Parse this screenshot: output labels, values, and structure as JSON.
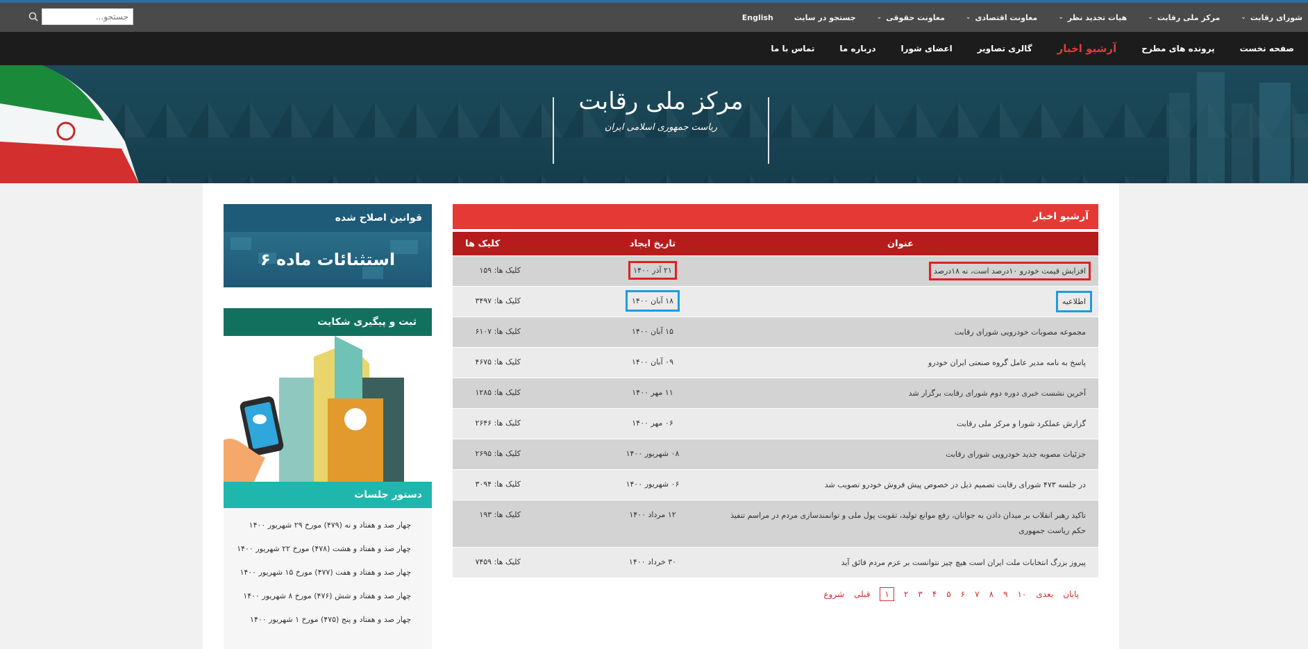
{
  "topbar": {
    "search_placeholder": "جستجو...",
    "items": [
      {
        "label": "شورای رقابت",
        "dropdown": true
      },
      {
        "label": "مرکز ملی رقابت",
        "dropdown": true
      },
      {
        "label": "هیات تجدید نظر",
        "dropdown": true
      },
      {
        "label": "معاونت اقتصادی",
        "dropdown": true
      },
      {
        "label": "معاونت حقوقی",
        "dropdown": true
      },
      {
        "label": "جستجو در سایت",
        "dropdown": false
      },
      {
        "label": "English",
        "dropdown": false
      }
    ]
  },
  "mainnav": {
    "items": [
      {
        "label": "صفحه نخست"
      },
      {
        "label": "پرونده های مطرح"
      },
      {
        "label": "آرشیو اخبار",
        "active": true
      },
      {
        "label": "گالری تصاویر"
      },
      {
        "label": "اعضای شورا"
      },
      {
        "label": "درباره ما"
      },
      {
        "label": "تماس با ما"
      }
    ]
  },
  "banner": {
    "title": "مرکز ملی رقابت",
    "subtitle": "ریاست جمهوری اسلامی ایران"
  },
  "archive": {
    "heading": "آرشیو اخبار",
    "columns": {
      "title": "عنوان",
      "date": "تاریخ ایجاد",
      "clicks": "کلیک ها"
    },
    "rows": [
      {
        "title": "افزایش قیمت خودرو ۱۰درصد است، نه ۱۸درصد",
        "date": "۲۱ آذر ۱۴۰۰",
        "clicks": "کلیک ها: ۱۵۹",
        "highlight": "red"
      },
      {
        "title": "اطلاعیه",
        "date": "۱۸ آبان ۱۴۰۰",
        "clicks": "کلیک ها: ۳۴۹۷",
        "highlight": "blue"
      },
      {
        "title": "مجموعه مصوبات خودرویی شورای رقابت",
        "date": "۱۵ آبان ۱۴۰۰",
        "clicks": "کلیک ها: ۶۱۰۷"
      },
      {
        "title": "پاسخ به نامه مدیر عامل گروه صنعتی ایران خودرو",
        "date": "۰۹ آبان ۱۴۰۰",
        "clicks": "کلیک ها: ۴۶۷۵"
      },
      {
        "title": "آخرین نشست خبری دوره دوم شورای رقابت برگزار شد",
        "date": "۱۱ مهر ۱۴۰۰",
        "clicks": "کلیک ها: ۱۲۸۵"
      },
      {
        "title": "گزارش عملکرد شورا و مرکز ملی رقابت",
        "date": "۰۶ مهر ۱۴۰۰",
        "clicks": "کلیک ها: ۲۶۴۶"
      },
      {
        "title": "جزئیات مصوبه جدید خودرویی شورای رقابت",
        "date": "۰۸ شهریور ۱۴۰۰",
        "clicks": "کلیک ها: ۲۶۹۵"
      },
      {
        "title": "در جلسه ۴۷۳ شورای رقابت تصمیم ذیل در خصوص پیش فروش خودرو تصویب شد",
        "date": "۰۶ شهریور ۱۴۰۰",
        "clicks": "کلیک ها: ۳۰۹۴"
      },
      {
        "title": "تاکید رهبر انقلاب بر میدان دادن به جوانان، رفع موانع تولید، تقویت پول ملی و توانمندسازی مردم در مراسم تنفیذ حکم ریاست جمهوری",
        "date": "۱۲ مرداد ۱۴۰۰",
        "clicks": "کلیک ها: ۱۹۳",
        "tall": true
      },
      {
        "title": "پیروز بزرگ انتخابات ملت ایران است هیچ چیز نتوانست بر عزم مردم فائق آید",
        "date": "۳۰ خرداد ۱۴۰۰",
        "clicks": "کلیک ها: ۷۴۵۹"
      }
    ],
    "pager": {
      "first": "شروع",
      "prev": "قبلی",
      "pages": [
        "۱",
        "۲",
        "۳",
        "۴",
        "۵",
        "۶",
        "۷",
        "۸",
        "۹",
        "۱۰"
      ],
      "current": "۱",
      "next": "بعدی",
      "last": "پایان"
    }
  },
  "sidebar": {
    "amended_laws": {
      "heading": "قوانین اصلاح شده",
      "image_text": "استثنائات ماده ۶"
    },
    "complaint": {
      "heading": "ثبت و پیگیری شکایت"
    },
    "agenda": {
      "heading": "دستور جلسات",
      "items": [
        "چهار صد و هفتاد و نه (۴۷۹) مورخ ۲۹ شهریور ۱۴۰۰",
        "چهار صد و هفتاد و هشت (۴۷۸) مورخ ۲۲ شهریور ۱۴۰۰",
        "چهار صد و هفتاد و هفت (۴۷۷) مورخ ۱۵ شهریور ۱۴۰۰",
        "چهار صد و هفتاد و شش (۴۷۶) مورخ ۸ شهریور ۱۴۰۰",
        "چهار صد و هفتاد و پنج (۴۷۵) مورخ ۱ شهریور ۱۴۰۰"
      ]
    }
  }
}
